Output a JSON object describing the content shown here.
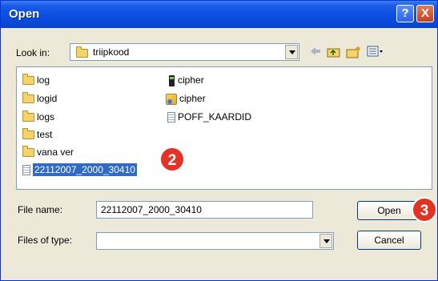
{
  "window": {
    "title": "Open"
  },
  "titlebar": {
    "help_glyph": "?",
    "close_glyph": "X"
  },
  "toolbar": {
    "look_in_label": "Look in:",
    "look_in_value": "triipkood"
  },
  "files": [
    {
      "name": "log",
      "type": "folder"
    },
    {
      "name": "logid",
      "type": "folder"
    },
    {
      "name": "logs",
      "type": "folder"
    },
    {
      "name": "test",
      "type": "folder"
    },
    {
      "name": "vana ver",
      "type": "folder"
    },
    {
      "name": "22112007_2000_30410",
      "type": "document",
      "selected": true
    },
    {
      "name": "cipher",
      "type": "executable"
    },
    {
      "name": "cipher",
      "type": "shortcut"
    },
    {
      "name": "POFF_KAARDID",
      "type": "document"
    }
  ],
  "annotations": {
    "step2": "2",
    "step3": "3"
  },
  "filename": {
    "label": "File name:",
    "value": "22112007_2000_30410"
  },
  "filetype": {
    "label": "Files of type:",
    "value": ""
  },
  "buttons": {
    "open": "Open",
    "cancel": "Cancel"
  },
  "icons": {
    "back": "back-arrow-icon",
    "up": "up-folder-icon",
    "newfolder": "new-folder-icon",
    "views": "views-menu-icon"
  },
  "colors": {
    "titlebar": "#0a4ee2",
    "selection": "#316ac5",
    "badge": "#e13326"
  }
}
